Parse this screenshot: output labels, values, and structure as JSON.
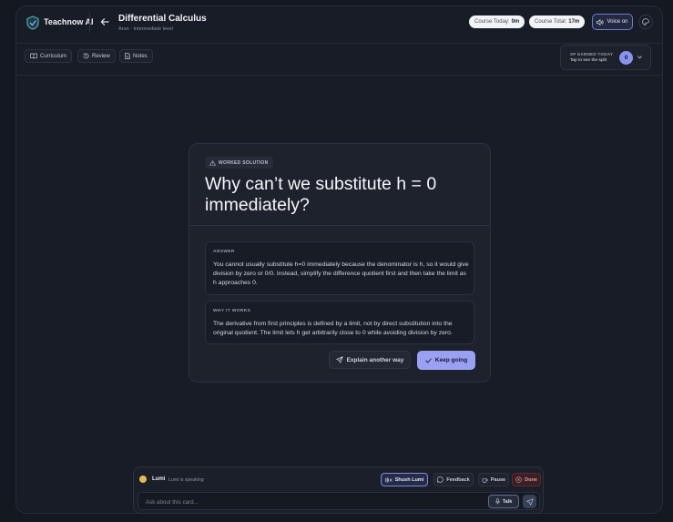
{
  "app": {
    "brand": "Teachnow AI"
  },
  "header": {
    "title": "Differential Calculus",
    "subtitle": "Arun · Intermediate level",
    "course_today_label": "Course Today:",
    "course_today_value": "0m",
    "course_total_label": "Course Total:",
    "course_total_value": "17m",
    "voice_label": "Voice on"
  },
  "nav": {
    "curriculum": "Curriculum",
    "review": "Review",
    "notes": "Notes"
  },
  "xp": {
    "title": "XP EARNED TODAY",
    "hint": "Tap to see the split",
    "value": "0"
  },
  "card": {
    "badge": "WORKED SOLUTION",
    "question": "Why can’t we substitute h = 0 immediately?",
    "answer_label": "ANSWER",
    "answer_text": "You cannot usually substitute h=0 immediately because the denominator is h, so it would give division by zero or 0/0. Instead, simplify the difference quotient first and then take the limit as h approaches 0.",
    "why_label": "WHY IT WORKS",
    "why_text": "The derivative from first principles is defined by a limit, not by direct substitution into the original quotient. The limit lets h get arbitrarily close to 0 while avoiding division by zero.",
    "explain_label": "Explain another way",
    "keep_label": "Keep going"
  },
  "assistant": {
    "name": "Lumi",
    "status": "Lumi is speaking",
    "shush_label": "Shush Lumi",
    "feedback_label": "Feedback",
    "pause_label": "Pause",
    "done_label": "Done",
    "ask_placeholder": "Ask about this card...",
    "talk_label": "Talk"
  },
  "colors": {
    "accent": "#9aa0f2",
    "background": "#141821",
    "panel": "#1d222d",
    "done": "#e69a9a"
  }
}
